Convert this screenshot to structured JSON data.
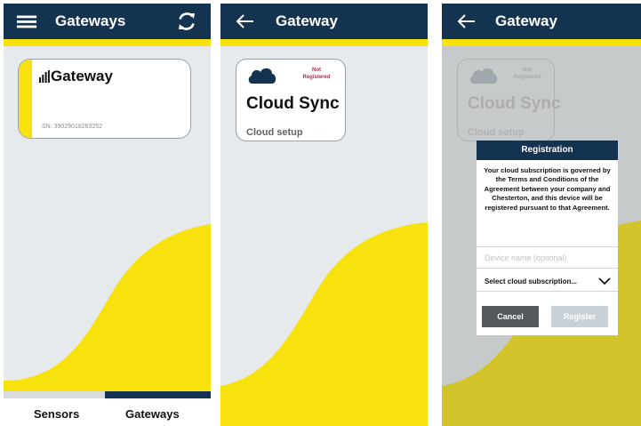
{
  "colors": {
    "navy": "#143350",
    "yellow": "#f7e20e",
    "panel": "#e6eaec"
  },
  "screen1": {
    "title": "Gateways",
    "gateway_card": {
      "name": "Gateway",
      "serial": "SN: 39029018263252"
    },
    "tabs": [
      {
        "label": "Sensors",
        "active": false
      },
      {
        "label": "Gateways",
        "active": true
      }
    ],
    "icons": [
      "menu-icon",
      "refresh-icon",
      "signal-icon"
    ]
  },
  "screen2": {
    "title": "Gateway",
    "card": {
      "badge": "Not Registered",
      "title": "Cloud Sync",
      "subtitle": "Cloud setup"
    },
    "icons": [
      "back-arrow-icon",
      "cloud-icon"
    ]
  },
  "screen3": {
    "title": "Gateway",
    "card": {
      "badge": "Not Registered",
      "title": "Cloud Sync",
      "subtitle": "Cloud setup"
    },
    "dialog": {
      "title": "Registration",
      "body": "Your cloud subscription is governed by the Terms and Conditions of the Agreement between your company and Chesterton, and this device will be registered pursuant to that Agreement.",
      "device_name_placeholder": "Device name (optional)",
      "subscription_select": "Select cloud subscription...",
      "cancel_label": "Cancel",
      "register_label": "Register"
    }
  }
}
